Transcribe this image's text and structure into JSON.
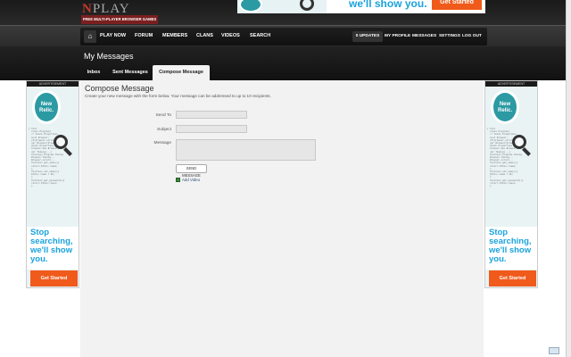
{
  "header": {
    "logo_n": "N",
    "logo_rest": "PLAY",
    "tagline": "FREE MULTI-PLAYER BROWSER GAMES",
    "top_ad": {
      "text": "we'll show you.",
      "button": "Get Started",
      "brand": "Relic"
    }
  },
  "nav": {
    "home_glyph": "⌂",
    "items": [
      "PLAY NOW",
      "FORUM",
      "MEMBERS",
      "CLANS",
      "VIDEOS",
      "SEARCH"
    ],
    "updates": "0 UPDATES",
    "right_items": [
      "MY PROFILE",
      "MESSAGES",
      "SETTINGS",
      "LOG OUT"
    ]
  },
  "page": {
    "title": "My Messages",
    "tabs": [
      {
        "label": "Inbox",
        "active": false
      },
      {
        "label": "Sent Messages",
        "active": false
      },
      {
        "label": "Compose Message",
        "active": true
      }
    ]
  },
  "compose": {
    "heading": "Compose Message",
    "description": "Create your new message with the form below. Your message can be addressed to up to 10 recipients.",
    "send_to_label": "Send To",
    "subject_label": "Subject",
    "message_label": "Message",
    "send_to_value": "",
    "subject_value": "",
    "message_value": "",
    "send_button": "SEND MESSAGE",
    "add_video": "Add Video"
  },
  "side_ads": {
    "label": "ADVERTISEMENT",
    "brand": "New Relic.",
    "pitch": "Stop searching, we'll show you.",
    "cta": "Get Started"
  },
  "colors": {
    "accent_red": "#7a1f1f",
    "ad_blue": "#1aa3dd",
    "ad_orange": "#f05a1a",
    "relic_teal": "#2b9aa3"
  }
}
